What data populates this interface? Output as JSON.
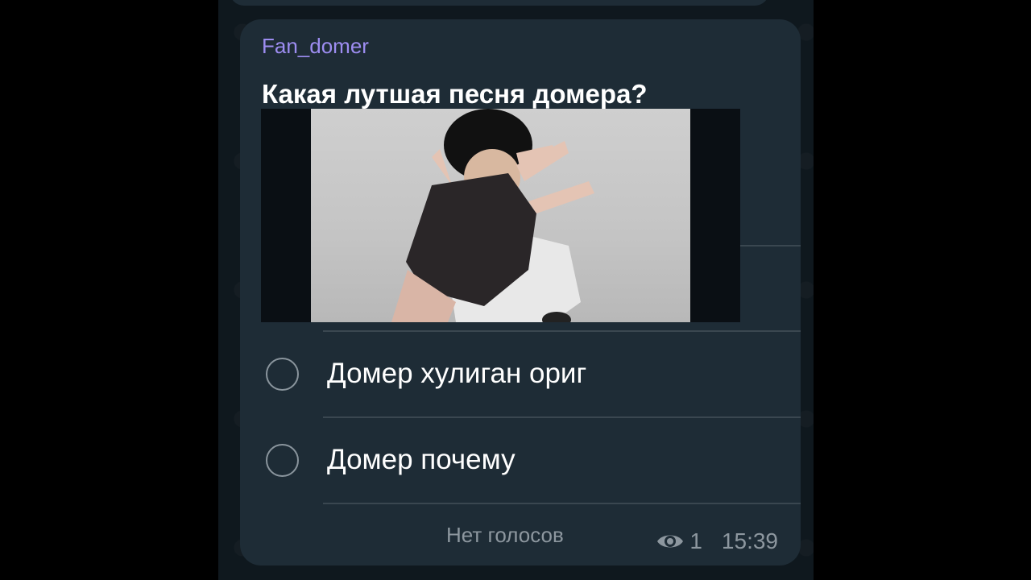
{
  "message": {
    "sender": "Fan_domer",
    "question": "Какая лутшая песня домера?",
    "media_alt": "video frame of a person raising a gloved hand toward the camera"
  },
  "poll": {
    "options": [
      {
        "label": "Домер хулиган ориг"
      },
      {
        "label": "Домер почему"
      }
    ],
    "status": "Нет голосов"
  },
  "meta": {
    "views": "1",
    "time": "15:39",
    "icon": "eye-icon"
  },
  "colors": {
    "bubble": "#1e2c36",
    "sender": "#9d8df1",
    "muted": "#8d979f"
  }
}
